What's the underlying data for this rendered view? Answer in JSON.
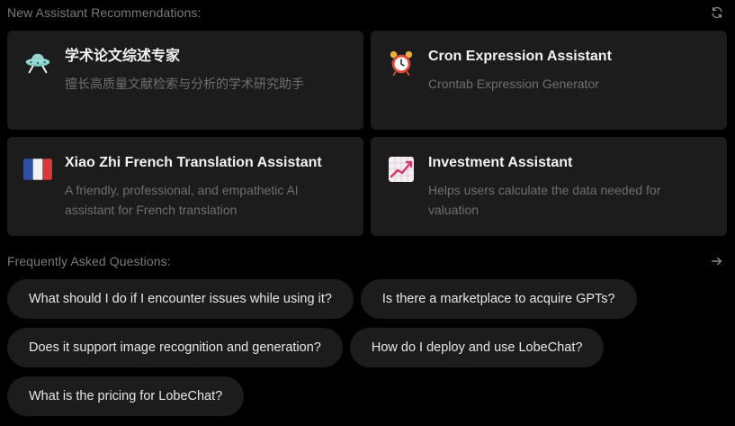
{
  "recommendations": {
    "title": "New Assistant Recommendations:",
    "refresh_icon": "refresh-icon",
    "cards": [
      {
        "icon": "ufo-icon",
        "title": "学术论文综述专家",
        "description": "擅长高质量文献检索与分析的学术研究助手"
      },
      {
        "icon": "alarm-clock-icon",
        "title": "Cron Expression Assistant",
        "description": "Crontab Expression Generator"
      },
      {
        "icon": "french-flag-icon",
        "title": "Xiao Zhi French Translation Assistant",
        "description": "A friendly, professional, and empathetic AI assistant for French translation"
      },
      {
        "icon": "chart-increasing-icon",
        "title": "Investment Assistant",
        "description": "Helps users calculate the data needed for valuation"
      }
    ]
  },
  "faq": {
    "title": "Frequently Asked Questions:",
    "more_icon": "arrow-right-icon",
    "questions": [
      "What should I do if I encounter issues while using it?",
      "Is there a marketplace to acquire GPTs?",
      "Does it support image recognition and generation?",
      "How do I deploy and use LobeChat?",
      "What is the pricing for LobeChat?"
    ]
  }
}
